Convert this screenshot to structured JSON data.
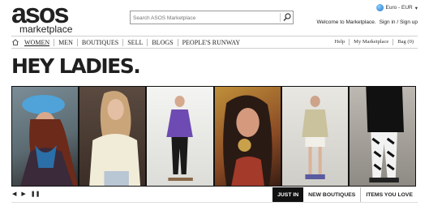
{
  "brand": {
    "name": "asos",
    "sub": "marketplace"
  },
  "search": {
    "placeholder": "Search ASOS Marketplace"
  },
  "account": {
    "currency": "Euro - EUR",
    "currency_caret": "▾",
    "welcome": "Welcome to Marketplace.",
    "sign_in": "Sign in / Sign up"
  },
  "nav": {
    "items": [
      "WOMEN",
      "MEN",
      "BOUTIQUES",
      "SELL",
      "BLOGS",
      "PEOPLE'S RUNWAY"
    ],
    "right": [
      "Help",
      "My Marketplace",
      "Bag (0)"
    ]
  },
  "hero": {
    "title": "HEY LADIES."
  },
  "carousel": {
    "prev": "◀",
    "next": "▶",
    "pause": "❚❚",
    "tabs": [
      "JUST IN",
      "NEW BOUTIQUES",
      "ITEMS YOU LOVE"
    ]
  },
  "colors": {
    "text": "#222222",
    "active_tab": "#111111",
    "globe": "#1d73c4"
  },
  "icons": [
    "home-icon",
    "search-icon",
    "globe-icon"
  ]
}
